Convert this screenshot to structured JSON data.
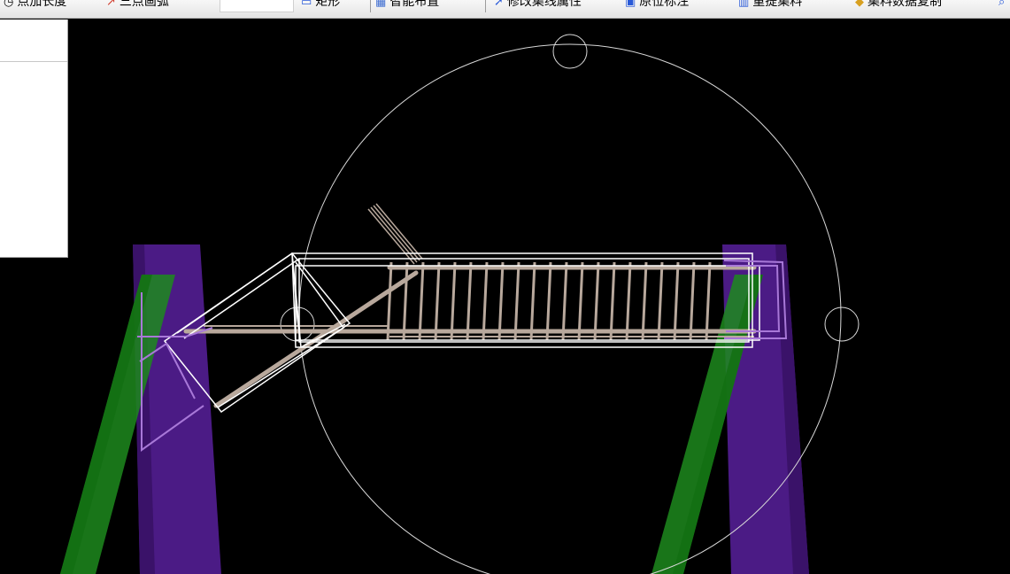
{
  "toolbar": {
    "items": [
      {
        "label": "点加长度",
        "icon": "clock-icon"
      },
      {
        "label": "三点画弧",
        "icon": "arc-icon"
      },
      {
        "label": "矩形",
        "icon": "rectangle-icon"
      },
      {
        "label": "智能布置",
        "icon": "smart-layout-icon"
      },
      {
        "label": "修改集线属性",
        "icon": "edit-properties-icon"
      },
      {
        "label": "原位标注",
        "icon": "annotation-icon"
      },
      {
        "label": "重提集料",
        "icon": "rebuild-icon"
      },
      {
        "label": "集料数据复制",
        "icon": "copy-data-icon"
      }
    ]
  },
  "colors": {
    "background": "#000000",
    "purple_column": "#5a1f9a",
    "green_column": "#1d8a1d",
    "frame_white": "#ffffff",
    "rebar_tan": "#b8a89c"
  }
}
